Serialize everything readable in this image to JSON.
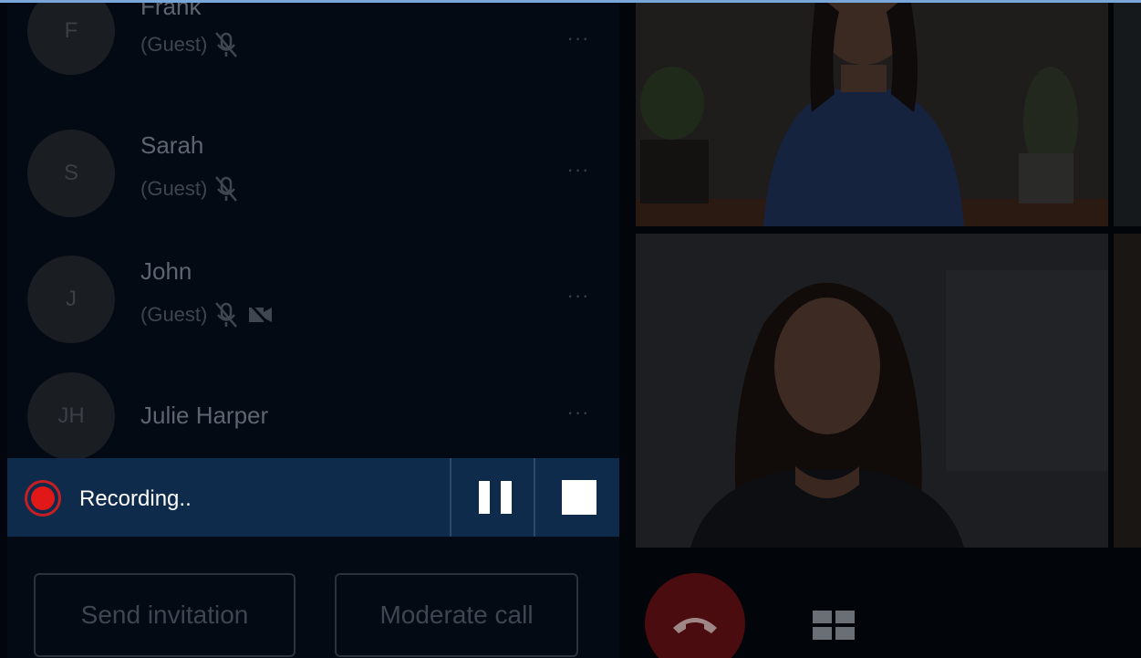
{
  "participants": [
    {
      "initials": "F",
      "name": "Frank",
      "role": "(Guest)",
      "more": "···"
    },
    {
      "initials": "S",
      "name": "Sarah",
      "role": "(Guest)",
      "more": "···"
    },
    {
      "initials": "J",
      "name": "John",
      "role": "(Guest)",
      "more": "···"
    },
    {
      "initials": "JH",
      "name": "Julie Harper",
      "more": "···"
    }
  ],
  "recording": {
    "label": "Recording.."
  },
  "buttons": {
    "send_invitation": "Send invitation",
    "moderate_call": "Moderate call"
  },
  "colors": {
    "accent": "#7aa7d9",
    "recording_bar": "#0f2b4b",
    "recording_dot": "#e01818",
    "hangup": "#4a0c0e"
  },
  "icons": {
    "muted": "mic-off-icon",
    "video_off": "video-off-icon",
    "more": "more-icon",
    "hangup": "hang-up-icon",
    "layout": "grid-layout-icon"
  }
}
